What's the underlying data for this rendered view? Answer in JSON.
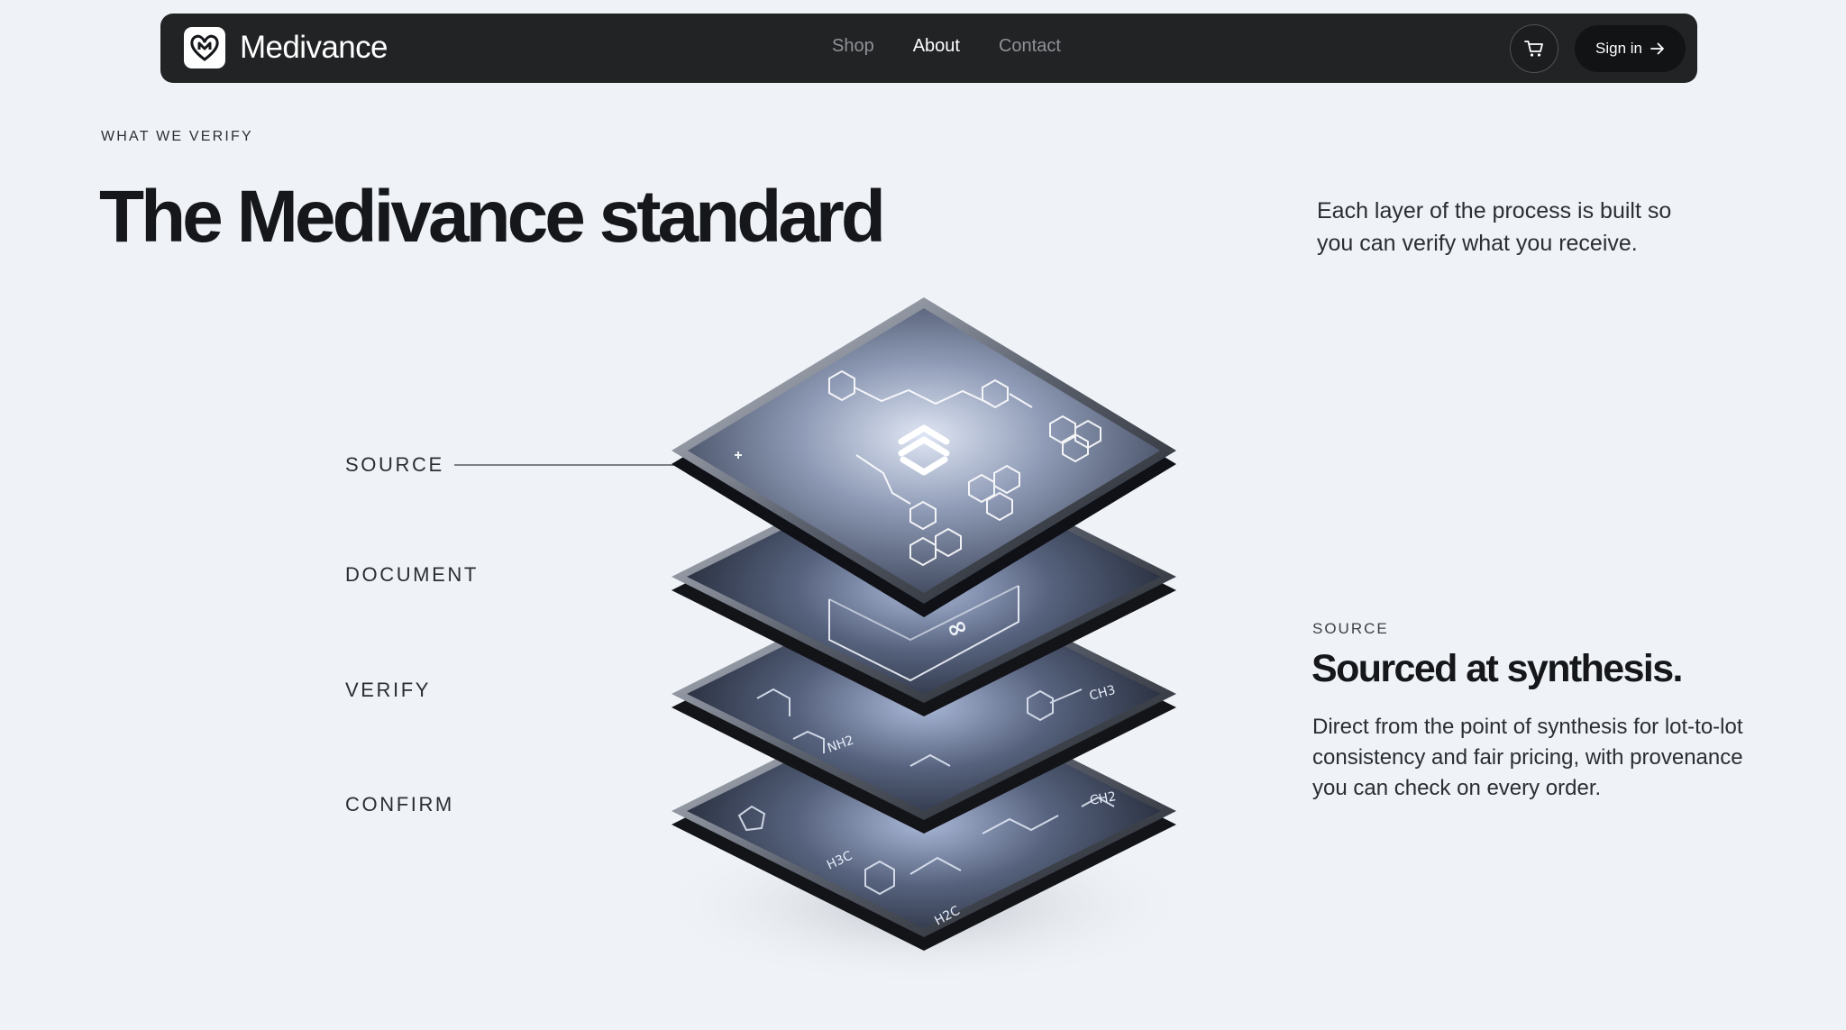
{
  "nav": {
    "brand": "Medivance",
    "links": [
      {
        "label": "Shop",
        "active": false
      },
      {
        "label": "About",
        "active": true
      },
      {
        "label": "Contact",
        "active": false
      }
    ],
    "cart_icon": "shopping-cart-icon",
    "signin_label": "Sign in",
    "signin_icon": "arrow-right-icon"
  },
  "hero": {
    "eyebrow": "WHAT WE VERIFY",
    "title": "The Medivance standard",
    "intro": "Each layer of the process is built so you can verify what you receive."
  },
  "layers": {
    "labels": [
      "SOURCE",
      "DOCUMENT",
      "VERIFY",
      "CONFIRM"
    ],
    "active_index": 0,
    "formula_tags": [
      "CH3",
      "NH2",
      "H3C",
      "H2C",
      "CH2"
    ]
  },
  "detail": {
    "eyebrow": "SOURCE",
    "title": "Sourced at synthesis.",
    "body": "Direct from the point of synthesis for lot-to-lot consistency and fair pricing, with provenance you can check on every order."
  },
  "colors": {
    "background": "#eff2f6",
    "navbar": "#222325",
    "text": "#15171a",
    "tile_dark": "#1d2230",
    "tile_glow": "#c7d3ee"
  }
}
